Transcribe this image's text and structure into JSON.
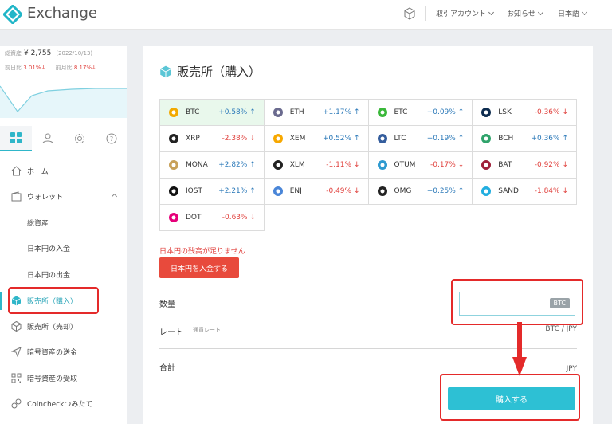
{
  "header": {
    "brand": "Exchange",
    "menus": [
      "取引アカウント",
      "お知らせ",
      "日本語"
    ]
  },
  "sidebar": {
    "asset_label": "総資産",
    "asset_value": "¥ 2,755",
    "asset_date": "(2022/10/13)",
    "day_label": "前日比",
    "day_value": "3.01%↓",
    "month_label": "前月比",
    "month_value": "8.17%↓",
    "items": [
      {
        "label": "ホーム"
      },
      {
        "label": "ウォレット"
      },
      {
        "label": "総資産"
      },
      {
        "label": "日本円の入金"
      },
      {
        "label": "日本円の出金"
      },
      {
        "label": "販売所（購入）"
      },
      {
        "label": "販売所（売却）"
      },
      {
        "label": "暗号資産の送金"
      },
      {
        "label": "暗号資産の受取"
      },
      {
        "label": "Coincheckつみたて"
      }
    ]
  },
  "main": {
    "title": "販売所（購入）",
    "coins": [
      [
        {
          "symbol": "BTC",
          "change": "+0.58%",
          "icon": "bitcoin-icon",
          "color": "#f2a900",
          "dir": "up"
        },
        {
          "symbol": "ETH",
          "change": "+1.17%",
          "icon": "ethereum-icon",
          "color": "#6b6b8f",
          "dir": "up"
        },
        {
          "symbol": "ETC",
          "change": "+0.09%",
          "icon": "ethereum-classic-icon",
          "color": "#3ab83a",
          "dir": "up"
        },
        {
          "symbol": "LSK",
          "change": "-0.36%",
          "icon": "lisk-icon",
          "color": "#0d2c4f",
          "dir": "down"
        }
      ],
      [
        {
          "symbol": "XRP",
          "change": "-2.38%",
          "icon": "ripple-icon",
          "color": "#222222",
          "dir": "down"
        },
        {
          "symbol": "XEM",
          "change": "+0.52%",
          "icon": "nem-icon",
          "color": "#f7a800",
          "dir": "up"
        },
        {
          "symbol": "LTC",
          "change": "+0.19%",
          "icon": "litecoin-icon",
          "color": "#345d9d",
          "dir": "up"
        },
        {
          "symbol": "BCH",
          "change": "+0.36%",
          "icon": "bitcoin-cash-icon",
          "color": "#2fa36b",
          "dir": "up"
        }
      ],
      [
        {
          "symbol": "MONA",
          "change": "+2.82%",
          "icon": "monacoin-icon",
          "color": "#c8a15a",
          "dir": "up"
        },
        {
          "symbol": "XLM",
          "change": "-1.11%",
          "icon": "stellar-icon",
          "color": "#222222",
          "dir": "down"
        },
        {
          "symbol": "QTUM",
          "change": "-0.17%",
          "icon": "qtum-icon",
          "color": "#2e9ad0",
          "dir": "down"
        },
        {
          "symbol": "BAT",
          "change": "-0.92%",
          "icon": "bat-icon",
          "color": "#a0213a",
          "dir": "down"
        }
      ],
      [
        {
          "symbol": "IOST",
          "change": "+2.21%",
          "icon": "iost-icon",
          "color": "#111111",
          "dir": "up"
        },
        {
          "symbol": "ENJ",
          "change": "-0.49%",
          "icon": "enjin-icon",
          "color": "#4a86d8",
          "dir": "down"
        },
        {
          "symbol": "OMG",
          "change": "+0.25%",
          "icon": "omg-icon",
          "color": "#222222",
          "dir": "up"
        },
        {
          "symbol": "SAND",
          "change": "-1.84%",
          "icon": "sandbox-icon",
          "color": "#22aee0",
          "dir": "down"
        }
      ],
      [
        {
          "symbol": "DOT",
          "change": "-0.63%",
          "icon": "polkadot-icon",
          "color": "#e6007a",
          "dir": "down"
        }
      ]
    ],
    "warning": "日本円の残高が足りません",
    "deposit_button": "日本円を入金する",
    "quantity_label": "数量",
    "quantity_unit": "BTC",
    "rate_label": "レート",
    "rate_sub": "通貨レート",
    "rate_pair": "BTC / JPY",
    "total_label": "合計",
    "total_unit": "JPY",
    "buy_button": "購入する"
  },
  "colors": {
    "accent": "#2dc0d4",
    "danger": "#e84a3c",
    "highlight": "#e42a2a"
  }
}
